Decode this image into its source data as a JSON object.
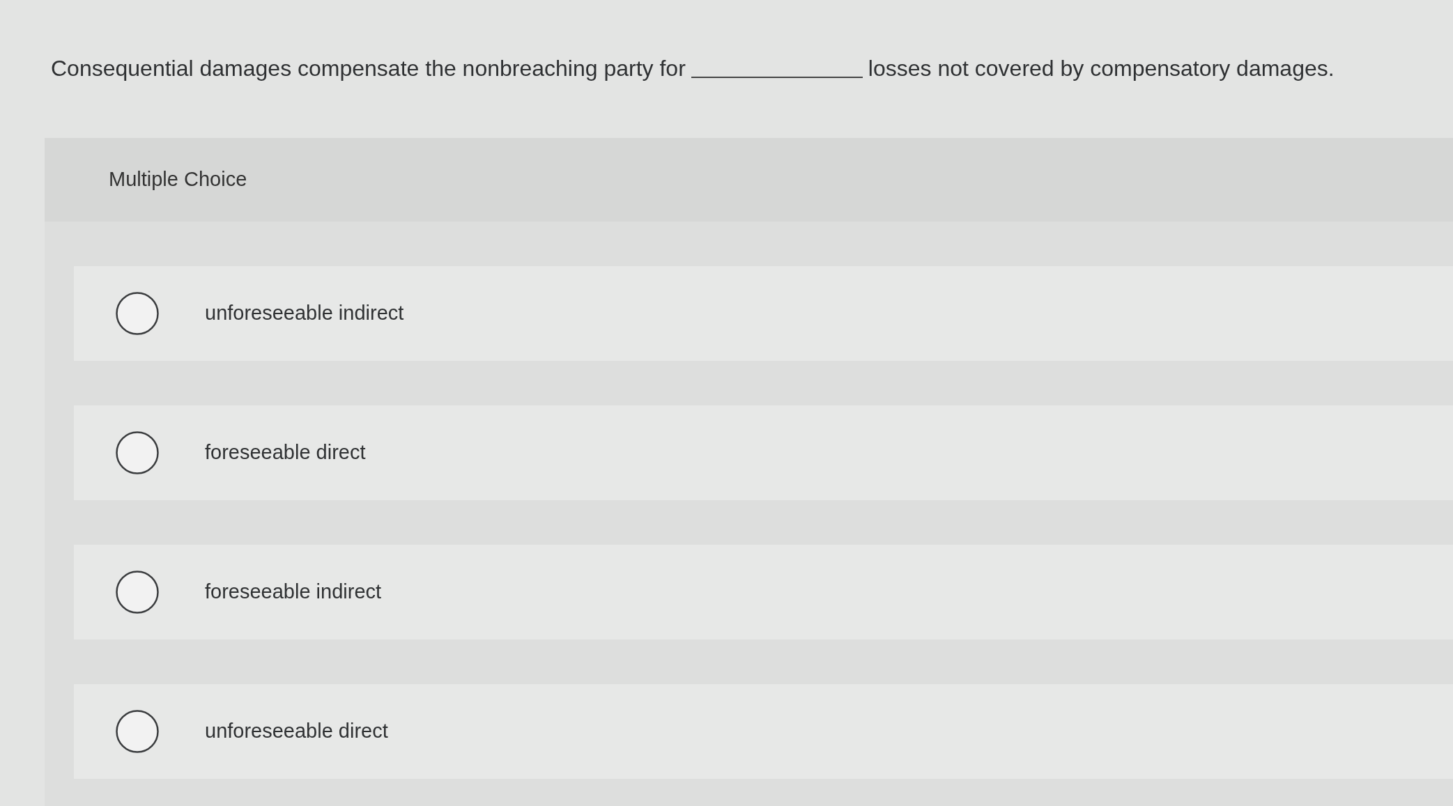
{
  "question": {
    "before_blank": "Consequential damages compensate the nonbreaching party for",
    "after_blank": "losses not covered by compensatory damages."
  },
  "answer_panel": {
    "heading": "Multiple Choice",
    "options": [
      {
        "label": "unforeseeable indirect",
        "selected": false
      },
      {
        "label": "foreseeable direct",
        "selected": false
      },
      {
        "label": "foreseeable indirect",
        "selected": false
      },
      {
        "label": "unforeseeable direct",
        "selected": false
      }
    ]
  }
}
